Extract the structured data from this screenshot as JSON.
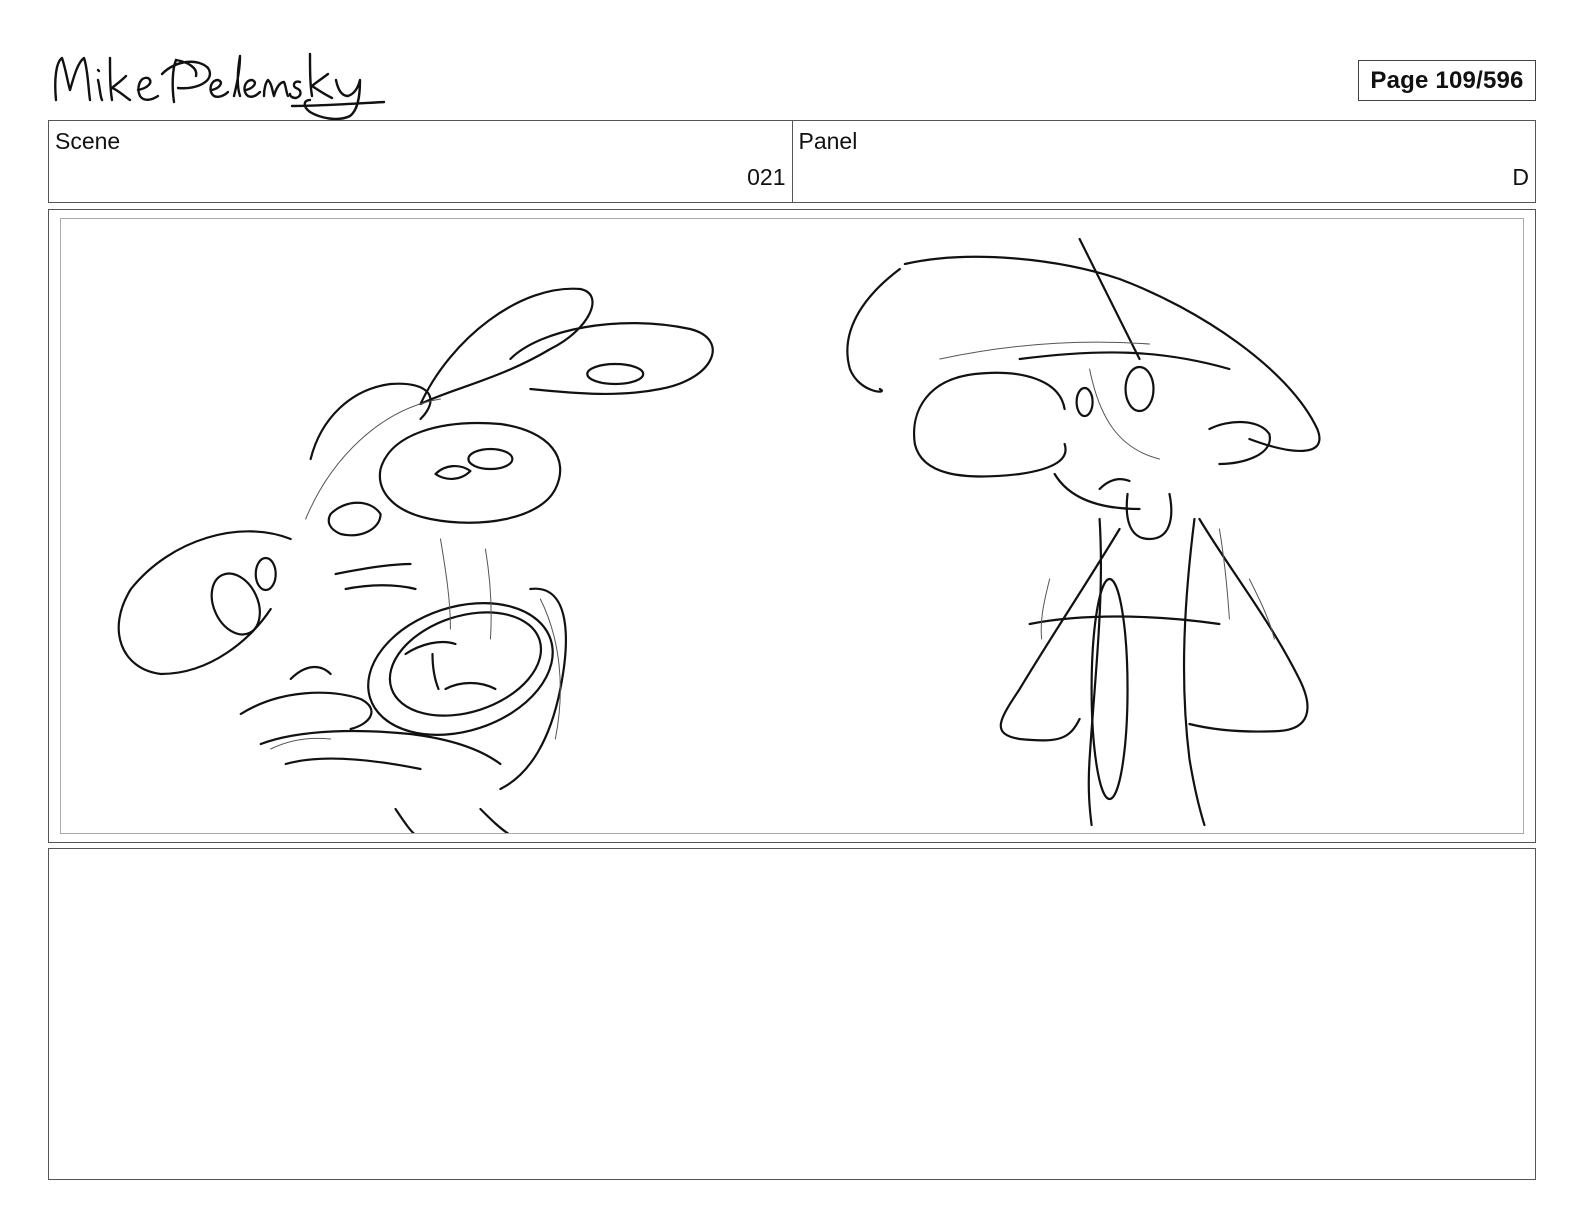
{
  "header": {
    "artist_signature": "Mike Pelensky",
    "page_indicator": "Page 109/596"
  },
  "info": {
    "scene_label": "Scene",
    "scene_value": "021",
    "panel_label": "Panel",
    "panel_value": "D"
  },
  "notes": {
    "text": ""
  }
}
